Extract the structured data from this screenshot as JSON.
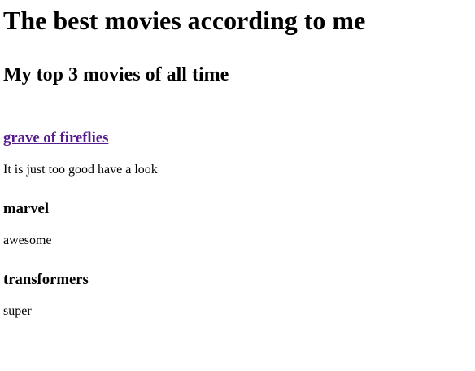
{
  "title": "The best movies according to me",
  "subtitle": "My top 3 movies of all time",
  "movies": [
    {
      "name": "grave of fireflies",
      "desc": "It is just too good have a look"
    },
    {
      "name": "marvel",
      "desc": "awesome"
    },
    {
      "name": "transformers",
      "desc": "super"
    }
  ]
}
